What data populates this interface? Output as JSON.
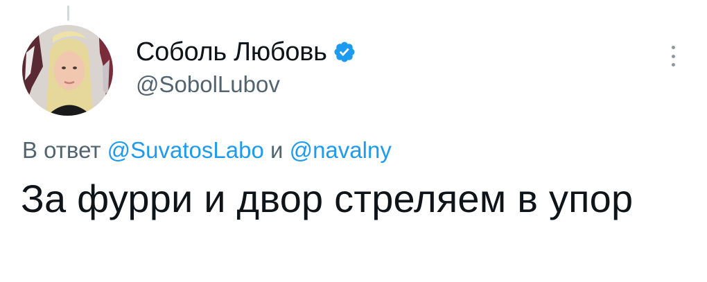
{
  "tweet": {
    "author": {
      "display_name": "Соболь Любовь",
      "handle": "@SobolLubov",
      "verified": true,
      "avatar_icon": "user-avatar-photo"
    },
    "reply_context": {
      "prefix": "В ответ",
      "mentions": [
        "@SuvatosLabo",
        "@navalny"
      ],
      "connector": "и"
    },
    "text": "За фурри и двор стреляем в упор",
    "more_icon": "vertical-ellipsis-icon"
  },
  "colors": {
    "accent": "#1d9bf0",
    "text_primary": "#0f1419",
    "text_secondary": "#536471",
    "thread_line": "#cfd9de"
  }
}
